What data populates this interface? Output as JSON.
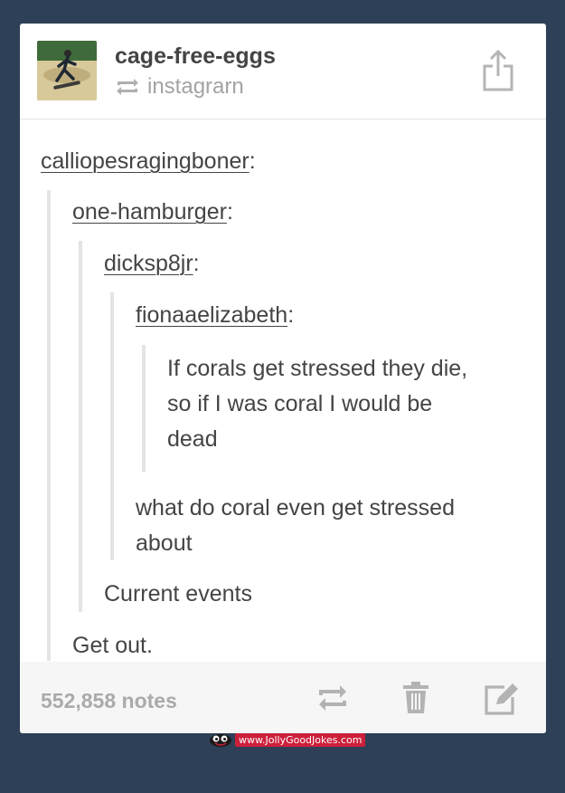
{
  "post": {
    "author": "cage-free-eggs",
    "source_label": "instagrarn",
    "thread": [
      {
        "name": "calliopesragingboner"
      },
      {
        "name": "one-hamburger"
      },
      {
        "name": "dicksp8jr"
      },
      {
        "name": "fionaaelizabeth"
      }
    ],
    "quote_lines": [
      "If corals get stressed they die,",
      "so if I was coral I would be",
      "dead"
    ],
    "reply_1_lines": [
      "what do coral even get stressed",
      "about"
    ],
    "reply_2": "Current events",
    "reply_3": "Get out.",
    "colon": ":"
  },
  "footer": {
    "notes": "552,858 notes"
  },
  "icons": {
    "share": "share-icon",
    "reblog_small": "reblog-icon",
    "reblog": "reblog-icon",
    "delete": "trash-icon",
    "edit": "edit-icon"
  },
  "colors": {
    "background": "#2e4057",
    "card": "#ffffff",
    "text": "#444444",
    "muted": "#a3a3a3",
    "thread_bar": "#e4e4e4",
    "footer_bg": "#f6f6f6"
  },
  "watermark": "www.JollyGoodJokes.com"
}
